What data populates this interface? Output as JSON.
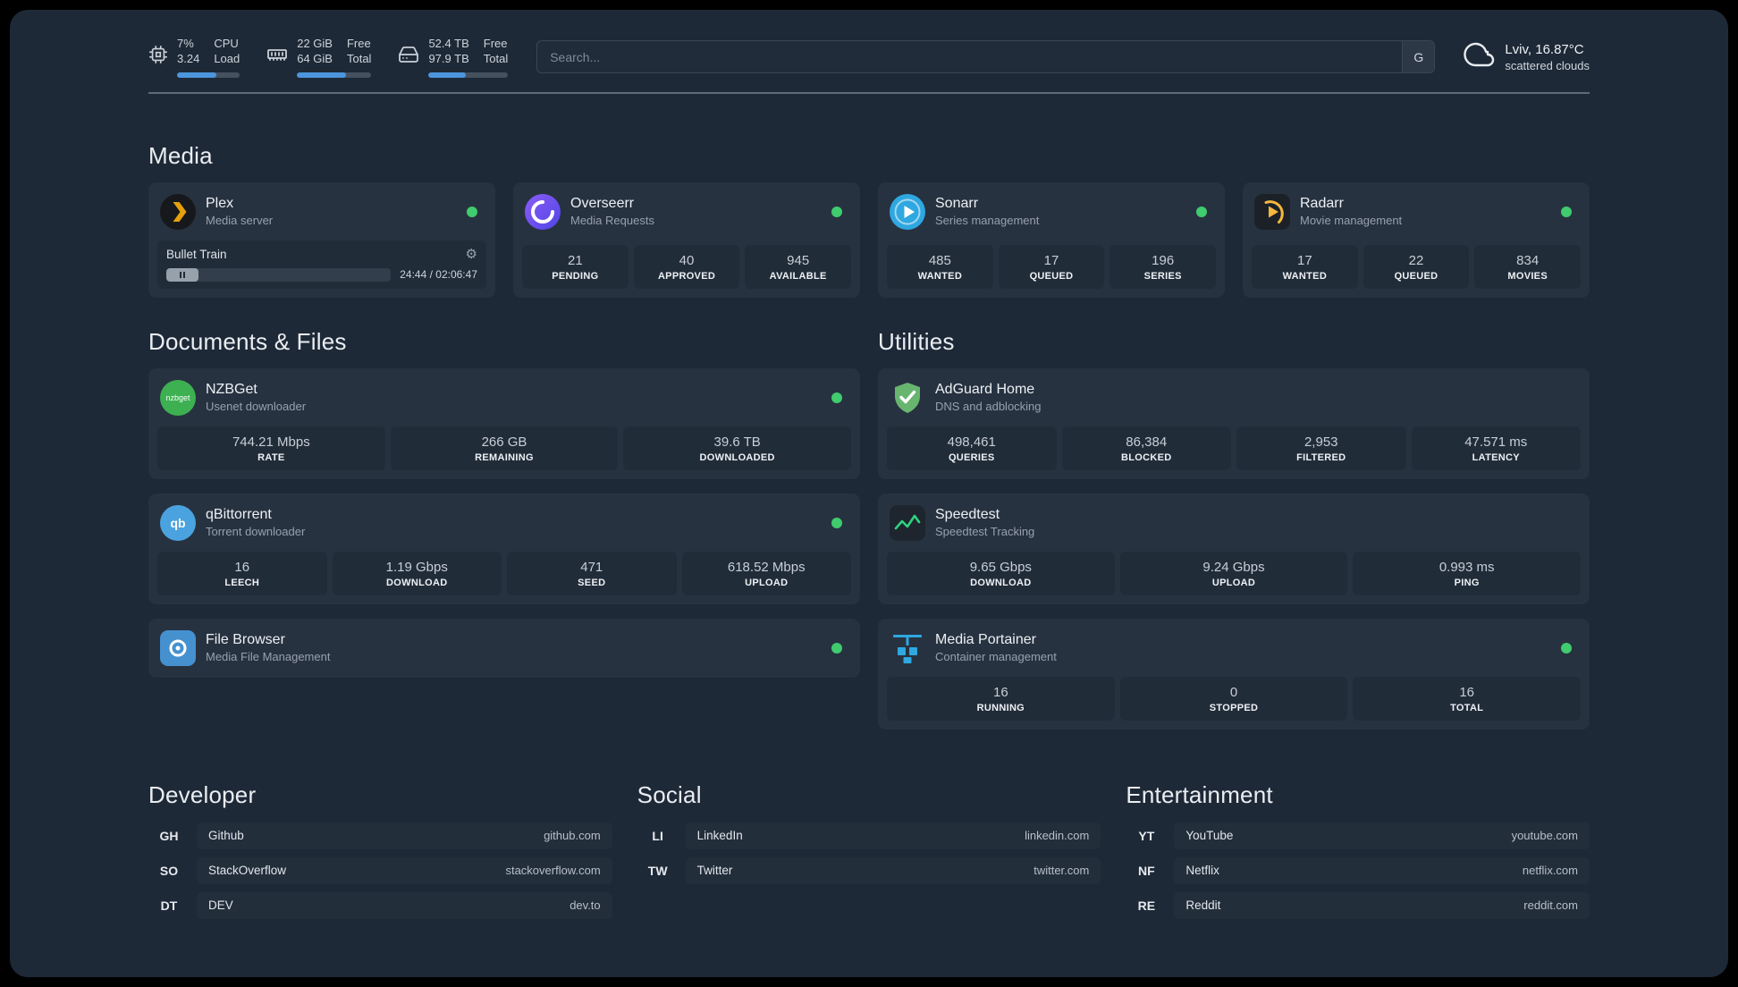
{
  "colors": {
    "background": "#1e2937",
    "card": "#273240",
    "tile": "#212c39",
    "status_green": "#3fcb6e",
    "progress_blue": "#4b96dd",
    "plex_gold": "#e5a00d"
  },
  "topbar": {
    "cpu": {
      "icon": "cpu-icon",
      "value_top": "7%",
      "value_bottom": "3.24",
      "label_top": "CPU",
      "label_bottom": "Load",
      "progress_percent": 62
    },
    "ram": {
      "icon": "ram-icon",
      "value_top": "22 GiB",
      "value_bottom": "64 GiB",
      "label_top": "Free",
      "label_bottom": "Total",
      "progress_percent": 66
    },
    "disk": {
      "icon": "disk-icon",
      "value_top": "52.4 TB",
      "value_bottom": "97.9 TB",
      "label_top": "Free",
      "label_bottom": "Total",
      "progress_percent": 47
    },
    "search": {
      "placeholder": "Search...",
      "button_label": "G"
    },
    "weather": {
      "icon": "cloud-icon",
      "location": "Lviv, 16.87°C",
      "condition": "scattered clouds"
    }
  },
  "sections": {
    "media": "Media",
    "documents": "Documents & Files",
    "utilities": "Utilities"
  },
  "apps": {
    "plex": {
      "name": "Plex",
      "subtitle": "Media server",
      "icon": "plex-icon",
      "online": true,
      "player": {
        "title": "Bullet Train",
        "time": "24:44 / 02:06:47",
        "gear_icon": "⚙",
        "state": "paused"
      }
    },
    "overseerr": {
      "name": "Overseerr",
      "subtitle": "Media Requests",
      "icon": "overseerr-icon",
      "online": true,
      "stats": [
        {
          "value": "21",
          "label": "PENDING"
        },
        {
          "value": "40",
          "label": "APPROVED"
        },
        {
          "value": "945",
          "label": "AVAILABLE"
        }
      ]
    },
    "sonarr": {
      "name": "Sonarr",
      "subtitle": "Series management",
      "icon": "sonarr-icon",
      "online": true,
      "stats": [
        {
          "value": "485",
          "label": "WANTED"
        },
        {
          "value": "17",
          "label": "QUEUED"
        },
        {
          "value": "196",
          "label": "SERIES"
        }
      ]
    },
    "radarr": {
      "name": "Radarr",
      "subtitle": "Movie management",
      "icon": "radarr-icon",
      "online": true,
      "stats": [
        {
          "value": "17",
          "label": "WANTED"
        },
        {
          "value": "22",
          "label": "QUEUED"
        },
        {
          "value": "834",
          "label": "MOVIES"
        }
      ]
    },
    "nzbget": {
      "name": "NZBGet",
      "subtitle": "Usenet downloader",
      "icon": "nzbget-icon",
      "online": true,
      "stats": [
        {
          "value": "744.21 Mbps",
          "label": "RATE"
        },
        {
          "value": "266 GB",
          "label": "REMAINING"
        },
        {
          "value": "39.6 TB",
          "label": "DOWNLOADED"
        }
      ]
    },
    "qbittorrent": {
      "name": "qBittorrent",
      "subtitle": "Torrent downloader",
      "icon": "qbittorrent-icon",
      "online": true,
      "stats": [
        {
          "value": "16",
          "label": "LEECH"
        },
        {
          "value": "1.19 Gbps",
          "label": "DOWNLOAD"
        },
        {
          "value": "471",
          "label": "SEED"
        },
        {
          "value": "618.52 Mbps",
          "label": "UPLOAD"
        }
      ]
    },
    "filebrowser": {
      "name": "File Browser",
      "subtitle": "Media File Management",
      "icon": "filebrowser-icon",
      "online": true
    },
    "adguard": {
      "name": "AdGuard Home",
      "subtitle": "DNS and adblocking",
      "icon": "adguard-icon",
      "stats": [
        {
          "value": "498,461",
          "label": "QUERIES"
        },
        {
          "value": "86,384",
          "label": "BLOCKED"
        },
        {
          "value": "2,953",
          "label": "FILTERED"
        },
        {
          "value": "47.571 ms",
          "label": "LATENCY"
        }
      ]
    },
    "speedtest": {
      "name": "Speedtest",
      "subtitle": "Speedtest Tracking",
      "icon": "speedtest-icon",
      "stats": [
        {
          "value": "9.65 Gbps",
          "label": "DOWNLOAD"
        },
        {
          "value": "9.24 Gbps",
          "label": "UPLOAD"
        },
        {
          "value": "0.993 ms",
          "label": "PING"
        }
      ]
    },
    "portainer": {
      "name": "Media Portainer",
      "subtitle": "Container management",
      "icon": "portainer-icon",
      "online": true,
      "stats": [
        {
          "value": "16",
          "label": "RUNNING"
        },
        {
          "value": "0",
          "label": "STOPPED"
        },
        {
          "value": "16",
          "label": "TOTAL"
        }
      ]
    }
  },
  "link_groups": {
    "developer": {
      "title": "Developer",
      "items": [
        {
          "abbr": "GH",
          "name": "Github",
          "url": "github.com"
        },
        {
          "abbr": "SO",
          "name": "StackOverflow",
          "url": "stackoverflow.com"
        },
        {
          "abbr": "DT",
          "name": "DEV",
          "url": "dev.to"
        }
      ]
    },
    "social": {
      "title": "Social",
      "items": [
        {
          "abbr": "LI",
          "name": "LinkedIn",
          "url": "linkedin.com"
        },
        {
          "abbr": "TW",
          "name": "Twitter",
          "url": "twitter.com"
        }
      ]
    },
    "entertainment": {
      "title": "Entertainment",
      "items": [
        {
          "abbr": "YT",
          "name": "YouTube",
          "url": "youtube.com"
        },
        {
          "abbr": "NF",
          "name": "Netflix",
          "url": "netflix.com"
        },
        {
          "abbr": "RE",
          "name": "Reddit",
          "url": "reddit.com"
        }
      ]
    }
  }
}
